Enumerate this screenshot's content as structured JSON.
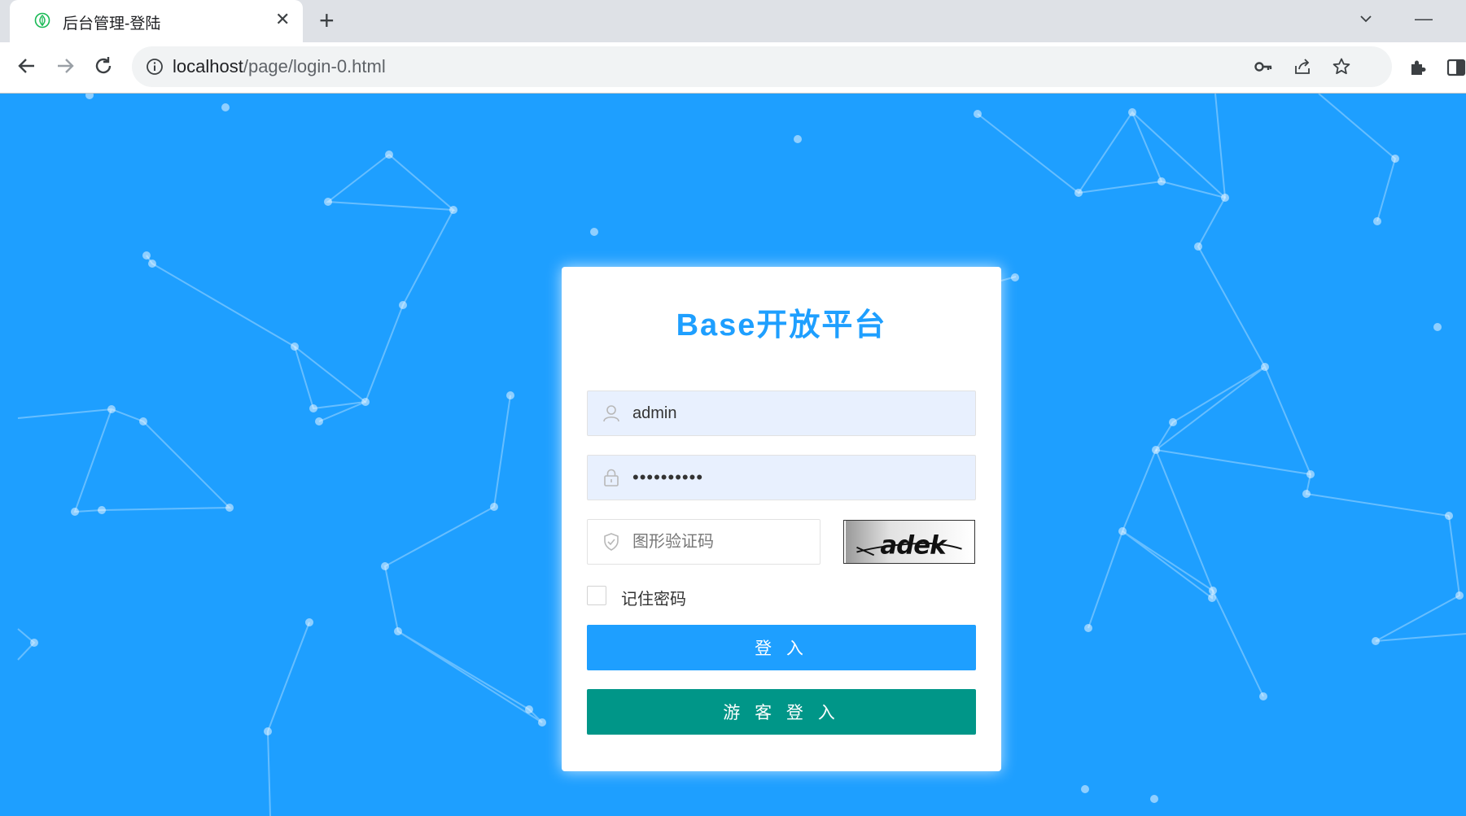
{
  "browser": {
    "tab_title": "后台管理-登陆",
    "tab_close": "✕",
    "new_tab": "+",
    "minimize": "—",
    "url_host": "localhost",
    "url_path": "/page/login-0.html"
  },
  "login": {
    "title": "Base开放平台",
    "username_value": "admin",
    "password_value": "••••••••••",
    "captcha_placeholder": "图形验证码",
    "captcha_image_text": "adek",
    "remember_label": "记住密码",
    "login_button": "登 入",
    "guest_button": "游 客 登 入"
  },
  "colors": {
    "background": "#1e9fff",
    "title": "#1e9fff",
    "login_button": "#1e9fff",
    "guest_button": "#009688",
    "autofill_field": "#e8f0fe"
  }
}
